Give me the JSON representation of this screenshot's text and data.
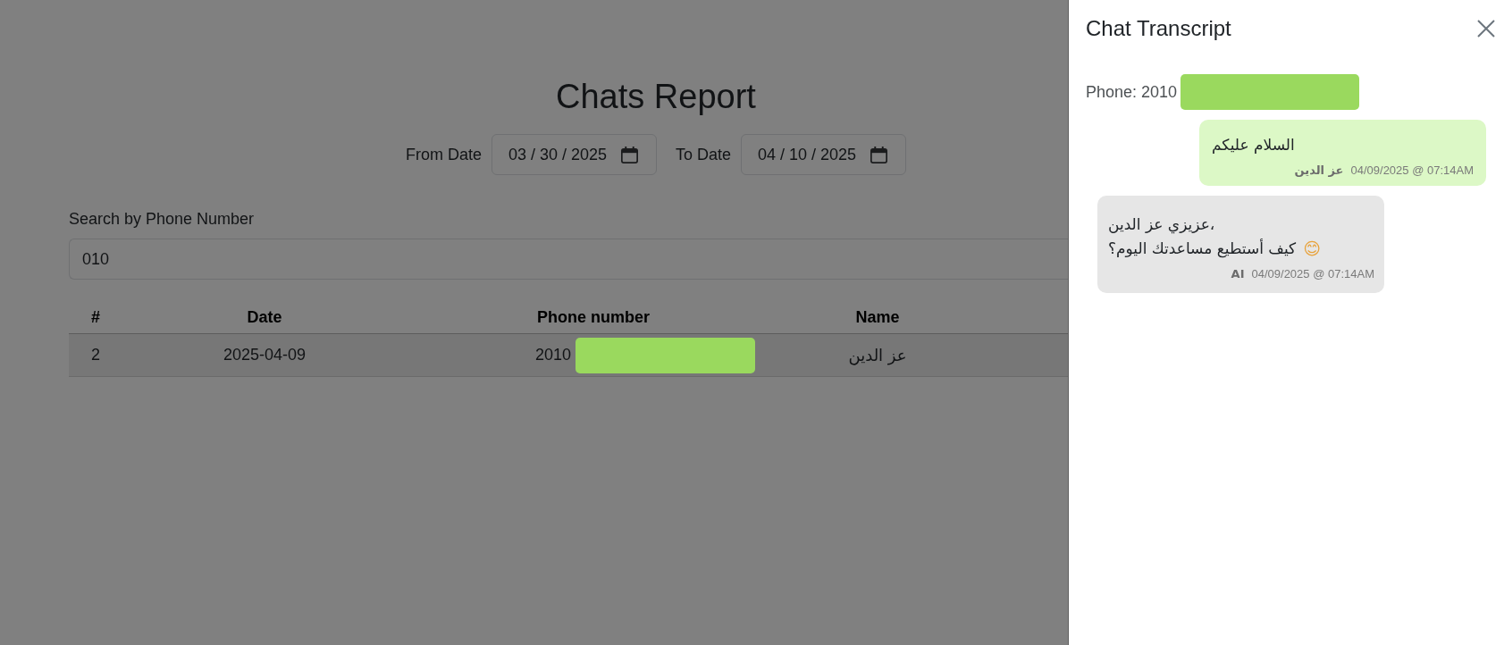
{
  "page": {
    "title": "Chats Report",
    "date_filters": [
      {
        "label": "From Date",
        "value": "03 / 30 / 2025"
      },
      {
        "label": "To Date",
        "value": "04 / 10 / 2025"
      }
    ],
    "search": {
      "label": "Search by Phone Number",
      "value": "010"
    },
    "table": {
      "columns": [
        "#",
        "Date",
        "Phone number",
        "Name"
      ],
      "rows": [
        {
          "number": "2",
          "date": "2025-04-09",
          "phone": {
            "text": "2010",
            "redacted": true
          },
          "name": "عز الدين"
        }
      ]
    }
  },
  "transcript_panel": {
    "title": "Chat Transcript",
    "phone": {
      "text": "Phone: 2010",
      "redacted": true
    },
    "messages": [
      {
        "kind": "customer",
        "lines": [
          "السلام عليكم"
        ],
        "sender": "عز الدين",
        "timestamp": "04/09/2025 @ 07:14AM"
      },
      {
        "kind": "ai",
        "lines": [
          "عزيزي عز الدين،",
          "كيف أستطيع مساعدتك اليوم؟"
        ],
        "emoji": "😊",
        "sender": "AI",
        "timestamp": "04/09/2025 @ 07:14AM"
      }
    ]
  }
}
